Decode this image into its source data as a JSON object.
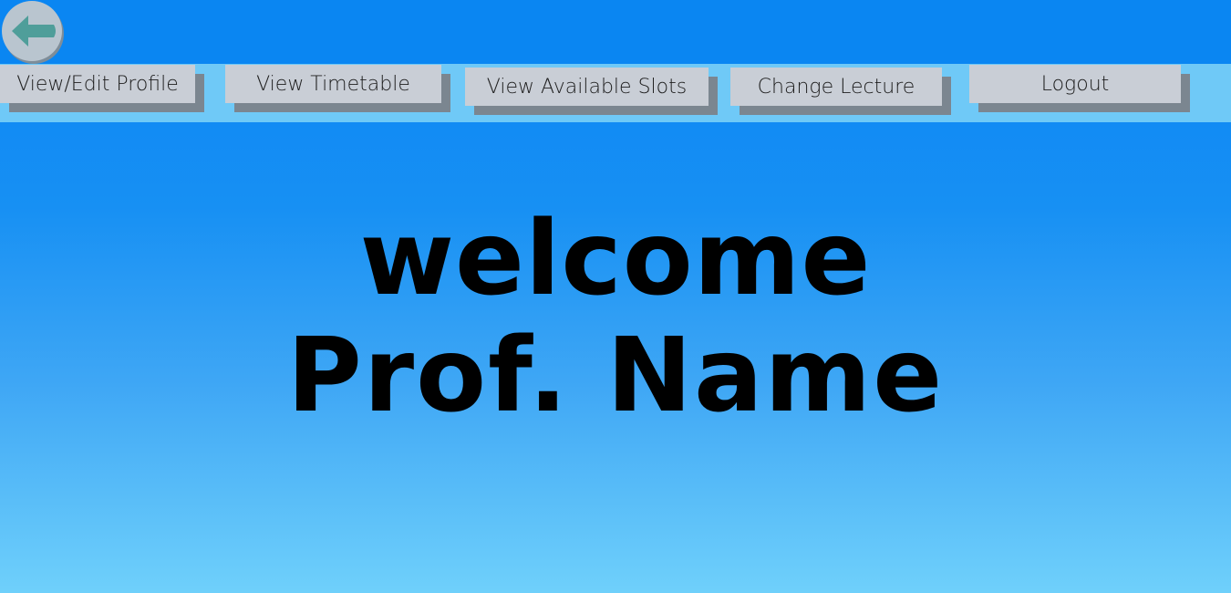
{
  "back_button": {
    "icon": "arrow-left-icon",
    "color": "#4f9e9a"
  },
  "nav": {
    "items": [
      {
        "label": "View/Edit Profile"
      },
      {
        "label": "View Timetable"
      },
      {
        "label": "View Available Slots"
      },
      {
        "label": "Change Lecture"
      },
      {
        "label": "Logout"
      }
    ]
  },
  "hero": {
    "line1": "welcome",
    "line2": "Prof. Name"
  }
}
